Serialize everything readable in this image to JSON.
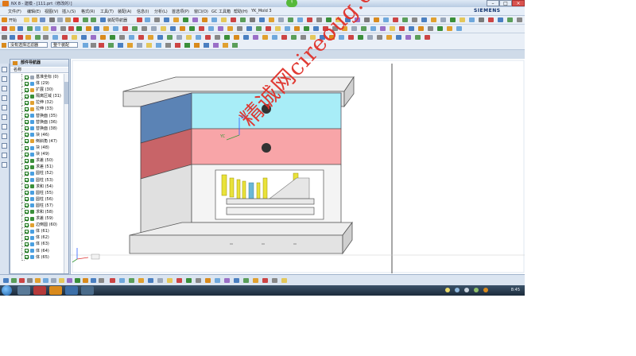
{
  "window": {
    "title": "NX 8 - 建模 - [111.prt（修改的）]",
    "brand": "SIEMENS",
    "minimize": "–",
    "maximize": "□",
    "close": "×"
  },
  "menu": [
    "文件(F)",
    "编辑(E)",
    "视图(V)",
    "插入(S)",
    "格式(R)",
    "工具(T)",
    "装配(A)",
    "信息(I)",
    "分析(L)",
    "首选项(P)",
    "窗口(O)",
    "GC 工具箱",
    "帮助(H)",
    "YK_Mold 3"
  ],
  "toolbar": {
    "start_label": "开始",
    "assembly_nav_label": "装配导航器"
  },
  "selection": {
    "filter_value": "没有选择过滤器",
    "scope_value": "整个装配"
  },
  "navigator": {
    "title": "部件导航器",
    "column_header": "名称",
    "rows": [
      {
        "label": "基准坐标 (0)",
        "color": "#9aa5b3"
      },
      {
        "label": "体 (29)",
        "color": "#4a9fe0"
      },
      {
        "label": "扩展 (30)",
        "color": "#e0a030"
      },
      {
        "label": "隔离区域 (31)",
        "color": "#3a8f3a"
      },
      {
        "label": "拉伸 (32)",
        "color": "#e0a030"
      },
      {
        "label": "拉伸 (33)",
        "color": "#e0a030"
      },
      {
        "label": "替换面 (35)",
        "color": "#4a9fe0"
      },
      {
        "label": "替换面 (36)",
        "color": "#4a9fe0"
      },
      {
        "label": "替换面 (38)",
        "color": "#4a9fe0"
      },
      {
        "label": "块 (46)",
        "color": "#4a9fe0"
      },
      {
        "label": "倒斜角 (47)",
        "color": "#e0a030"
      },
      {
        "label": "块 (48)",
        "color": "#4a9fe0"
      },
      {
        "label": "块 (49)",
        "color": "#4a9fe0"
      },
      {
        "label": "求差 (50)",
        "color": "#3a8f3a"
      },
      {
        "label": "求差 (51)",
        "color": "#3a8f3a"
      },
      {
        "label": "圆柱 (52)",
        "color": "#4a9fe0"
      },
      {
        "label": "圆柱 (53)",
        "color": "#4a9fe0"
      },
      {
        "label": "求和 (54)",
        "color": "#3a8f3a"
      },
      {
        "label": "圆柱 (55)",
        "color": "#4a9fe0"
      },
      {
        "label": "圆柱 (56)",
        "color": "#4a9fe0"
      },
      {
        "label": "圆柱 (57)",
        "color": "#4a9fe0"
      },
      {
        "label": "求和 (58)",
        "color": "#3a8f3a"
      },
      {
        "label": "求差 (59)",
        "color": "#3a8f3a"
      },
      {
        "label": "边倒圆 (60)",
        "color": "#e0a030"
      },
      {
        "label": "体 (61)",
        "color": "#4a9fe0"
      },
      {
        "label": "体 (62)",
        "color": "#4a9fe0"
      },
      {
        "label": "体 (63)",
        "color": "#4a9fe0"
      },
      {
        "label": "体 (64)",
        "color": "#4a9fe0"
      },
      {
        "label": "体 (65)",
        "color": "#4a9fe0"
      }
    ]
  },
  "viewport": {
    "axis_z": "ZC",
    "axis_y": "YC"
  },
  "watermark": "精诚网cireoug.com",
  "taskbar": {
    "clock": "8:45"
  }
}
